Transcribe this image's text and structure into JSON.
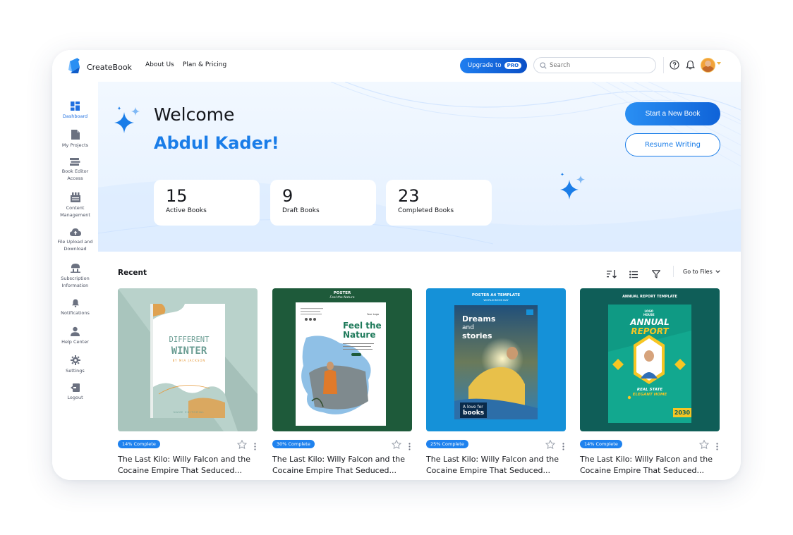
{
  "app": {
    "brand": "CreateBook",
    "nav": [
      "About Us",
      "Plan & Pricing"
    ],
    "upgrade_label": "Upgrade to",
    "upgrade_badge": "PRO",
    "search_placeholder": "Search"
  },
  "sidebar": {
    "items": [
      {
        "label": "Dashboard",
        "icon": "dashboard-icon",
        "active": true
      },
      {
        "label": "My Projects",
        "icon": "document-icon"
      },
      {
        "label": "Book Editor Access",
        "icon": "books-stack-icon"
      },
      {
        "label": "Content Management",
        "icon": "content-management-icon"
      },
      {
        "label": "File Upload and Download",
        "icon": "cloud-upload-icon"
      },
      {
        "label": "Subscription Information",
        "icon": "subscription-icon"
      },
      {
        "label": "Notifications",
        "icon": "bell-icon"
      },
      {
        "label": "Help Center",
        "icon": "help-center-icon"
      },
      {
        "label": "Settings",
        "icon": "gear-icon"
      },
      {
        "label": "Logout",
        "icon": "logout-icon"
      }
    ]
  },
  "hero": {
    "welcome": "Welcome",
    "name": "Abdul Kader!",
    "start_button": "Start a New Book",
    "resume_button": "Resume Writing",
    "stats": [
      {
        "value": "15",
        "label": "Active Books"
      },
      {
        "value": "9",
        "label": "Draft Books"
      },
      {
        "value": "23",
        "label": "Completed Books"
      }
    ]
  },
  "recent": {
    "title": "Recent",
    "go_to_files": "Go to Files",
    "books": [
      {
        "badge": "14% Complete",
        "title": "The Last Kilo: Willy Falcon and the Cocaine Empire That Seduced...",
        "cover": {
          "line1": "DIFFERENT",
          "line2": "WINTER",
          "author": "BY MIA JACKSON",
          "footer": "NAME EDITORIAL"
        }
      },
      {
        "badge": "30% Complete",
        "title": "The Last Kilo: Willy Falcon and the Cocaine Empire That Seduced...",
        "cover": {
          "label": "POSTER",
          "sub": "Feel the Nature",
          "headline_1": "Feel the",
          "headline_2": "Nature",
          "logo": "Your Logo"
        }
      },
      {
        "badge": "25% Complete",
        "title": "The Last Kilo: Willy Falcon and the Cocaine Empire That Seduced...",
        "cover": {
          "label": "POSTER A4 TEMPLATE",
          "sub": "WORLD BOOK DAY",
          "headline_1": "Dreams",
          "headline_2": "and",
          "headline_3": "stories",
          "tag_1": "A love for",
          "tag_2": "books"
        }
      },
      {
        "badge": "14% Complete",
        "title": "The Last Kilo: Willy Falcon and the Cocaine Empire That Seduced...",
        "cover": {
          "label": "ANNUAL REPORT TEMPLATE",
          "logo_1": "LOGO",
          "logo_2": "HOUSE",
          "headline_1": "ANNUAL",
          "headline_2": "REPORT",
          "caption_1": "REAL STATE",
          "caption_2": "ELEGANT HOME",
          "year": "2030"
        }
      }
    ]
  }
}
